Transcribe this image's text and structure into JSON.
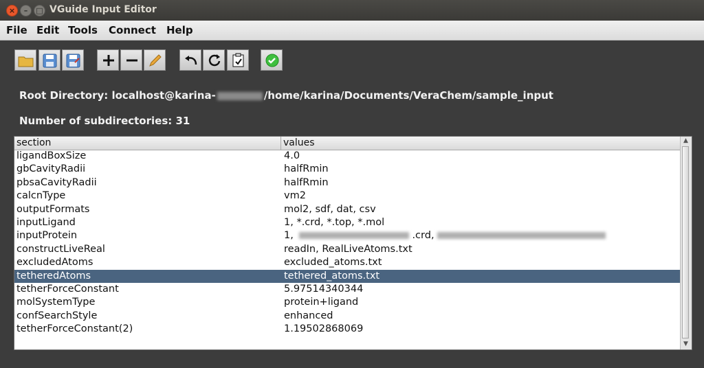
{
  "window": {
    "title": "VGuide Input Editor"
  },
  "menu": [
    "File",
    "Edit",
    "Tools",
    "Connect",
    "Help"
  ],
  "toolbar": {
    "groups": [
      [
        "open-folder-icon",
        "save-icon",
        "save-as-icon"
      ],
      [
        "plus-icon",
        "minus-icon",
        "pencil-icon"
      ],
      [
        "undo-icon",
        "refresh-icon",
        "clipboard-check-icon"
      ],
      [
        "check-circle-icon"
      ]
    ]
  },
  "info": {
    "root_label": "Root Directory: localhost@karina-",
    "root_path": "/home/karina/Documents/VeraChem/sample_input",
    "subdirs": "Number of subdirectories: 31"
  },
  "table": {
    "columns": [
      "section",
      "values"
    ],
    "rows": [
      [
        "ligandBoxSize",
        "4.0"
      ],
      [
        "gbCavityRadii",
        "halfRmin"
      ],
      [
        "pbsaCavityRadii",
        "halfRmin"
      ],
      [
        "calcnType",
        "vm2"
      ],
      [
        "outputFormats",
        "mol2, sdf, dat, csv"
      ],
      [
        "inputLigand",
        "1, *.crd, *.top, *.mol"
      ],
      [
        "inputProtein",
        "1, "
      ],
      [
        "constructLiveReal",
        "readIn, RealLiveAtoms.txt"
      ],
      [
        "excludedAtoms",
        "excluded_atoms.txt"
      ],
      [
        "tetheredAtoms",
        "tethered_atoms.txt"
      ],
      [
        "tetherForceConstant",
        "5.97514340344"
      ],
      [
        "molSystemType",
        "protein+ligand"
      ],
      [
        "confSearchStyle",
        "enhanced"
      ],
      [
        "tetherForceConstant(2)",
        "1.19502868069"
      ]
    ],
    "selected_index": 9,
    "input_protein_mid": ".crd,"
  },
  "colors": {
    "selection": "#4a6480",
    "background": "#3c3c3c"
  }
}
